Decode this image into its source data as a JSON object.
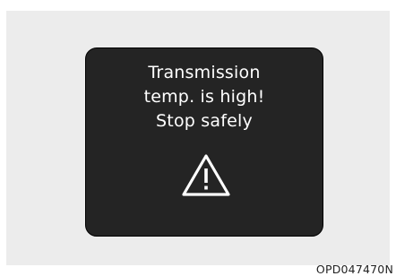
{
  "display": {
    "message_lines": [
      "Transmission",
      "temp. is high!",
      "Stop safely"
    ],
    "icon": "warning-triangle-icon",
    "background_color": "#242424",
    "text_color": "#ffffff"
  },
  "figure_code": "OPD047470N"
}
